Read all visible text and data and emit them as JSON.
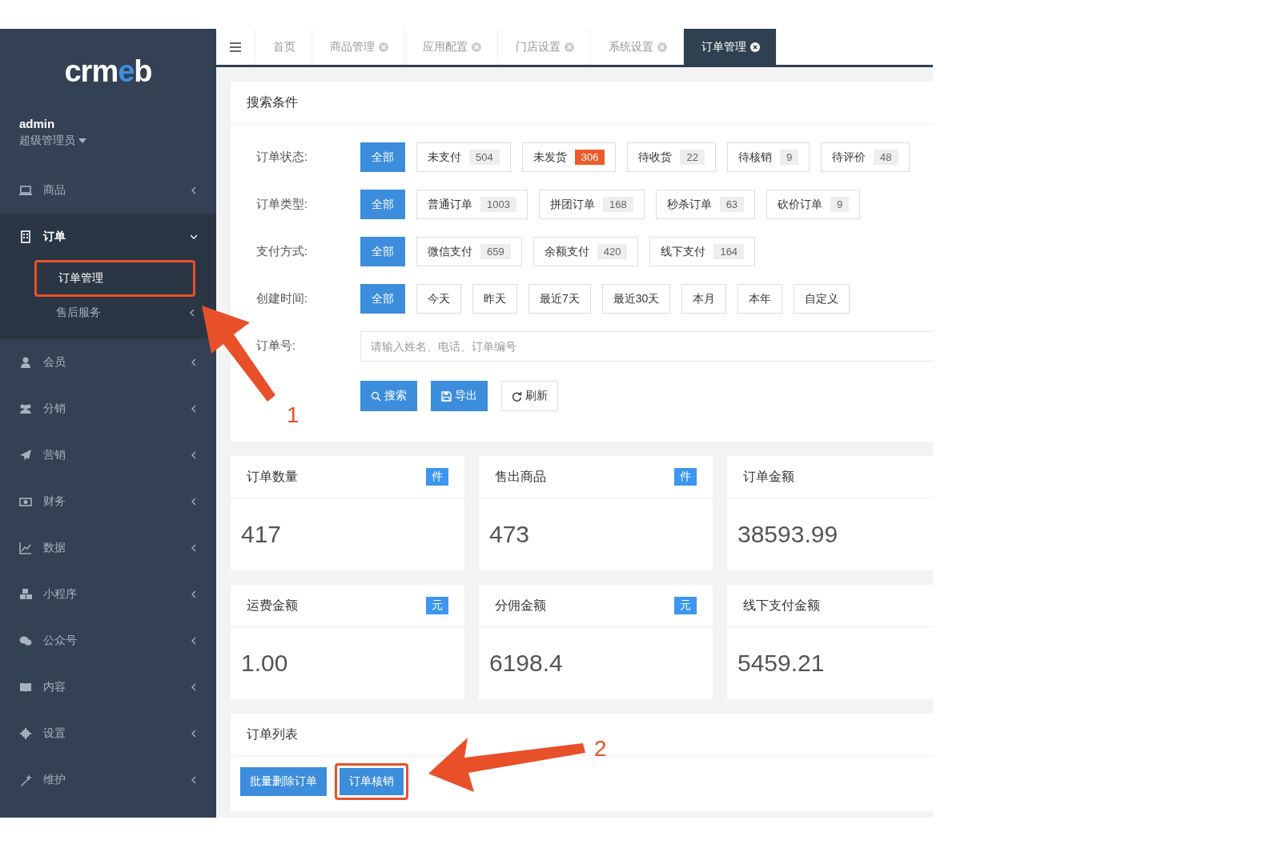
{
  "logo": [
    {
      "text": "crm",
      "color": "#ffffff"
    },
    {
      "text": "e",
      "color": "#3d8fe0"
    },
    {
      "text": "b",
      "color": "#ffffff"
    }
  ],
  "user": {
    "name": "admin",
    "role": "超级管理员"
  },
  "menu": [
    {
      "label": "商品",
      "expanded": false
    },
    {
      "label": "订单",
      "expanded": true,
      "children": [
        {
          "label": "订单管理",
          "selected": true
        },
        {
          "label": "售后服务",
          "selected": false
        }
      ]
    },
    {
      "label": "会员",
      "expanded": false
    },
    {
      "label": "分销",
      "expanded": false
    },
    {
      "label": "营销",
      "expanded": false
    },
    {
      "label": "财务",
      "expanded": false
    },
    {
      "label": "数据",
      "expanded": false
    },
    {
      "label": "小程序",
      "expanded": false
    },
    {
      "label": "公众号",
      "expanded": false
    },
    {
      "label": "内容",
      "expanded": false
    },
    {
      "label": "设置",
      "expanded": false
    },
    {
      "label": "维护",
      "expanded": false
    }
  ],
  "tabs": [
    {
      "label": "首页",
      "closable": false,
      "selected": false
    },
    {
      "label": "商品管理",
      "closable": true,
      "selected": false
    },
    {
      "label": "应用配置",
      "closable": true,
      "selected": false
    },
    {
      "label": "门店设置",
      "closable": true,
      "selected": false
    },
    {
      "label": "系统设置",
      "closable": true,
      "selected": false
    },
    {
      "label": "订单管理",
      "closable": true,
      "selected": true
    }
  ],
  "search": {
    "title": "搜索条件",
    "filters": [
      {
        "label": "订单状态:",
        "options": [
          {
            "label": "全部",
            "selected": true
          },
          {
            "label": "未支付",
            "count": "504",
            "alert": false,
            "selected": false
          },
          {
            "label": "未发货",
            "count": "306",
            "alert": true,
            "selected": false
          },
          {
            "label": "待收货",
            "count": "22",
            "alert": false,
            "selected": false
          },
          {
            "label": "待核销",
            "count": "9",
            "alert": false,
            "selected": false
          },
          {
            "label": "待评价",
            "count": "48",
            "alert": false,
            "selected": false
          }
        ]
      },
      {
        "label": "订单类型:",
        "options": [
          {
            "label": "全部",
            "selected": true
          },
          {
            "label": "普通订单",
            "count": "1003",
            "alert": false,
            "selected": false
          },
          {
            "label": "拼团订单",
            "count": "168",
            "alert": false,
            "selected": false
          },
          {
            "label": "秒杀订单",
            "count": "63",
            "alert": false,
            "selected": false
          },
          {
            "label": "砍价订单",
            "count": "9",
            "alert": false,
            "selected": false
          }
        ]
      },
      {
        "label": "支付方式:",
        "options": [
          {
            "label": "全部",
            "selected": true
          },
          {
            "label": "微信支付",
            "count": "659",
            "alert": false,
            "selected": false
          },
          {
            "label": "余额支付",
            "count": "420",
            "alert": false,
            "selected": false
          },
          {
            "label": "线下支付",
            "count": "164",
            "alert": false,
            "selected": false
          }
        ]
      },
      {
        "label": "创建时间:",
        "options": [
          {
            "label": "全部",
            "selected": true
          },
          {
            "label": "今天",
            "selected": false
          },
          {
            "label": "昨天",
            "selected": false
          },
          {
            "label": "最近7天",
            "selected": false
          },
          {
            "label": "最近30天",
            "selected": false
          },
          {
            "label": "本月",
            "selected": false
          },
          {
            "label": "本年",
            "selected": false
          },
          {
            "label": "自定义",
            "selected": false
          }
        ]
      }
    ],
    "order_no": {
      "label": "订单号:",
      "placeholder": "请输入姓名、电话、订单编号"
    },
    "buttons": [
      {
        "label": "搜索",
        "kind": "search"
      },
      {
        "label": "导出",
        "kind": "export"
      },
      {
        "label": "刷新",
        "kind": "refresh"
      }
    ]
  },
  "stats": [
    {
      "title": "订单数量",
      "unit": "件",
      "value": "417"
    },
    {
      "title": "售出商品",
      "unit": "件",
      "value": "473"
    },
    {
      "title": "订单金额",
      "value": "38593.99"
    },
    {
      "title": "运费金额",
      "unit": "元",
      "value": "1.00"
    },
    {
      "title": "分佣金额",
      "unit": "元",
      "value": "6198.4"
    },
    {
      "title": "线下支付金额",
      "value": "5459.21"
    }
  ],
  "order_list": {
    "title": "订单列表",
    "buttons": [
      {
        "label": "批量删除订单",
        "highlighted": false
      },
      {
        "label": "订单核销",
        "highlighted": true
      }
    ]
  },
  "annotations": [
    {
      "number": "1"
    },
    {
      "number": "2"
    }
  ]
}
